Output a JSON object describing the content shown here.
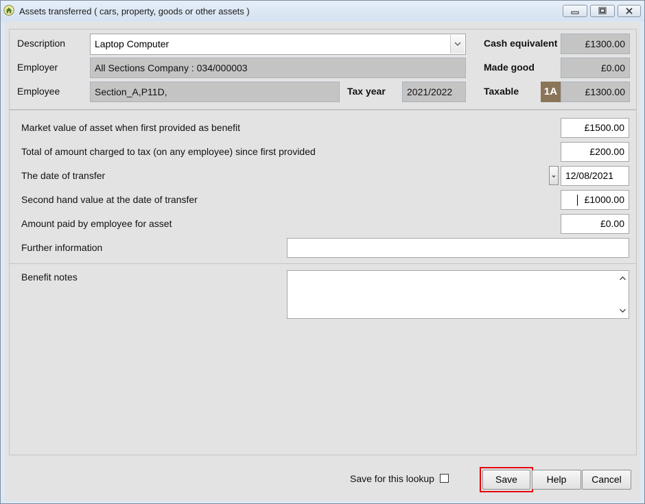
{
  "window": {
    "title": "Assets transferred ( cars, property, goods or other assets )",
    "controls": [
      "minimize-icon",
      "maximize-icon",
      "close-icon"
    ]
  },
  "header": {
    "description_label": "Description",
    "description_value": "Laptop Computer",
    "employer_label": "Employer",
    "employer_value": "All Sections Company : 034/000003",
    "employee_label": "Employee",
    "employee_value": "Section_A,P11D,",
    "tax_year_label": "Tax year",
    "tax_year_value": "2021/2022",
    "cash_equivalent_label": "Cash equivalent",
    "cash_equivalent_value": "£1300.00",
    "made_good_label": "Made good",
    "made_good_value": "£0.00",
    "taxable_label": "Taxable",
    "taxable_badge": "1A",
    "taxable_value": "£1300.00"
  },
  "fields": {
    "market_value_label": "Market value of asset when first provided as benefit",
    "market_value": "£1500.00",
    "total_charged_label": "Total of amount charged to tax (on any employee) since first provided",
    "total_charged": "£200.00",
    "date_transfer_label": "The date of transfer",
    "date_transfer": "12/08/2021",
    "second_hand_label": "Second hand value at the date of transfer",
    "second_hand_value": "£1000.00",
    "amount_paid_label": "Amount paid by employee for asset",
    "amount_paid": "£0.00",
    "further_info_label": "Further information",
    "further_info": ""
  },
  "notes": {
    "label": "Benefit notes",
    "value": ""
  },
  "footer": {
    "save_lookup_label": "Save for this lookup",
    "save_lookup_checked": false,
    "save_label": "Save",
    "help_label": "Help",
    "cancel_label": "Cancel",
    "highlight_color": "#e8000d"
  },
  "colors": {
    "badge_bg": "#8a7559",
    "readonly_bg": "#c4c4c4"
  }
}
